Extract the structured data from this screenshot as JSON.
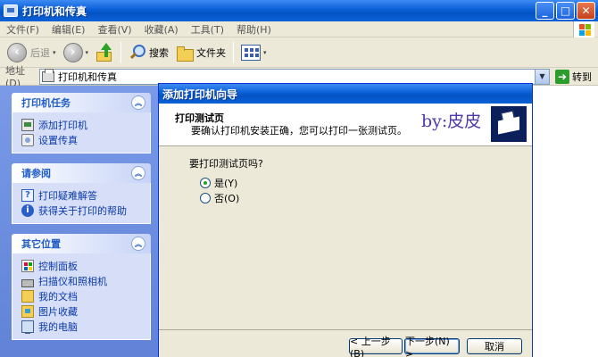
{
  "window": {
    "title": "打印机和传真",
    "min_label": "_",
    "max_label": "□",
    "close_label": "✕"
  },
  "menu": [
    "文件(F)",
    "编辑(E)",
    "查看(V)",
    "收藏(A)",
    "工具(T)",
    "帮助(H)"
  ],
  "toolbar": {
    "back_label": "后退",
    "back_glyph": "‹",
    "forward_glyph": "›",
    "search_label": "搜索",
    "folders_label": "文件夹",
    "dropdown_glyph": "▾"
  },
  "address": {
    "label": "地址(D)",
    "value": "打印机和传真",
    "drop_glyph": "▼",
    "go_label": "转到",
    "go_glyph": "➜"
  },
  "sidebar": {
    "collapse_glyph": "︽",
    "panels": [
      {
        "title": "打印机任务",
        "items": [
          "添加打印机",
          "设置传真"
        ]
      },
      {
        "title": "请参阅",
        "items": [
          "打印疑难解答",
          "获得关于打印的帮助"
        ]
      },
      {
        "title": "其它位置",
        "items": [
          "控制面板",
          "扫描仪和照相机",
          "我的文档",
          "图片收藏",
          "我的电脑"
        ]
      }
    ],
    "help_glyph": "?",
    "info_glyph": "i"
  },
  "wizard": {
    "title": "添加打印机向导",
    "header_title": "打印测试页",
    "header_subtitle": "要确认打印机安装正确，您可以打印一张测试页。",
    "watermark": "by:皮皮",
    "question": "要打印测试页吗?",
    "options": [
      "是(Y)",
      "否(O)"
    ],
    "selected_option": 0,
    "back_button": "< 上一步(B)",
    "next_button": "下一步(N) >",
    "cancel_button": "取消"
  },
  "colors": {
    "titlebar": "#0a5fd8",
    "sidebar_bg": "#6f8fe0",
    "link": "#0c3aa8",
    "panel_title": "#215dc6"
  }
}
